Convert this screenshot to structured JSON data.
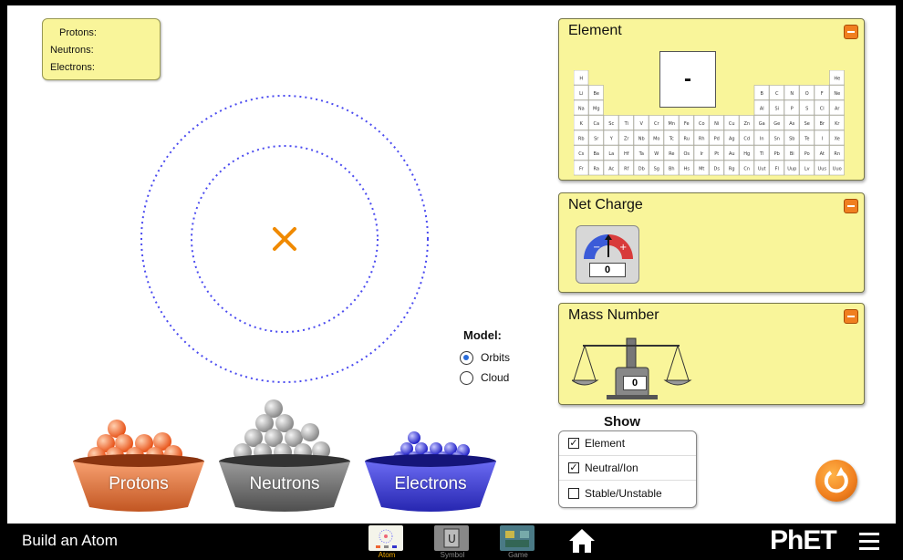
{
  "counts": {
    "protons_label": "Protons:",
    "neutrons_label": "Neutrons:",
    "electrons_label": "Electrons:"
  },
  "model": {
    "title": "Model:",
    "options": [
      "Orbits",
      "Cloud"
    ],
    "selected": "Orbits"
  },
  "buckets": {
    "protons": "Protons",
    "neutrons": "Neutrons",
    "electrons": "Electrons"
  },
  "element_panel": {
    "title": "Element",
    "symbol": "-"
  },
  "net_charge_panel": {
    "title": "Net Charge",
    "value": "0"
  },
  "mass_number_panel": {
    "title": "Mass Number",
    "value": "0"
  },
  "show": {
    "title": "Show",
    "options": [
      {
        "label": "Element",
        "checked": true
      },
      {
        "label": "Neutral/Ion",
        "checked": true
      },
      {
        "label": "Stable/Unstable",
        "checked": false
      }
    ]
  },
  "navbar": {
    "app_title": "Build an Atom",
    "tabs": [
      {
        "label": "Atom",
        "selected": true
      },
      {
        "label": "Symbol",
        "selected": false
      },
      {
        "label": "Game",
        "selected": false
      }
    ],
    "logo": "PhET"
  },
  "periodic_table": {
    "row1": [
      "H",
      "He"
    ],
    "row2_left": [
      "Li",
      "Be"
    ],
    "row2_right": [
      "B",
      "C",
      "N",
      "O",
      "F",
      "Ne"
    ],
    "row3_left": [
      "Na",
      "Mg"
    ],
    "row3_right": [
      "Al",
      "Si",
      "P",
      "S",
      "Cl",
      "Ar"
    ],
    "row4": [
      "K",
      "Ca",
      "Sc",
      "Ti",
      "V",
      "Cr",
      "Mn",
      "Fe",
      "Co",
      "Ni",
      "Cu",
      "Zn",
      "Ga",
      "Ge",
      "As",
      "Se",
      "Br",
      "Kr"
    ],
    "row5": [
      "Rb",
      "Sr",
      "Y",
      "Zr",
      "Nb",
      "Mo",
      "Tc",
      "Ru",
      "Rh",
      "Pd",
      "Ag",
      "Cd",
      "In",
      "Sn",
      "Sb",
      "Te",
      "I",
      "Xe"
    ],
    "row6": [
      "Cs",
      "Ba",
      "La",
      "Hf",
      "Ta",
      "W",
      "Re",
      "Os",
      "Ir",
      "Pt",
      "Au",
      "Hg",
      "Tl",
      "Pb",
      "Bi",
      "Po",
      "At",
      "Rn"
    ],
    "row7": [
      "Fr",
      "Ra",
      "Ac",
      "Rf",
      "Db",
      "Sg",
      "Bh",
      "Hs",
      "Mt",
      "Ds",
      "Rg",
      "Cn",
      "Uut",
      "Fl",
      "Uup",
      "Lv",
      "Uus",
      "Uuo"
    ]
  },
  "colors": {
    "panel_bg": "#f9f59a",
    "accent": "#f07f1f",
    "proton": "#f47a3d",
    "neutron": "#9e9e9e",
    "electron": "#3b3bd6",
    "orbit": "#4b4bf0"
  }
}
